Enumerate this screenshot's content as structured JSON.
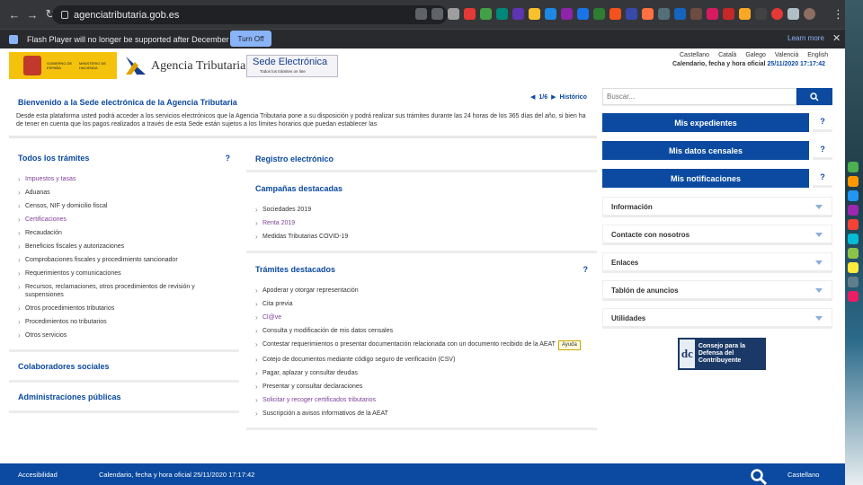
{
  "browser": {
    "url": "agenciatributaria.gob.es",
    "flash_message": "Flash Player will no longer be supported after December 2020.",
    "turn_off_label": "Turn Off",
    "learn_more_label": "Learn more",
    "close_label": "✕",
    "back": "←",
    "forward": "→",
    "reload": "↻",
    "menu": "⋮"
  },
  "header": {
    "gov_text": "GOBIERNO DE ESPAÑA",
    "ministry_text": "MINISTERIO DE HACIENDA",
    "agency_title": "Agencia Tributaria",
    "sede_title": "Sede Electrónica",
    "sede_subtitle": "Todos los trámites on line",
    "languages": [
      "Castellano",
      "Català",
      "Galego",
      "Valencià",
      "English"
    ],
    "datetime_label": "Calendario, fecha y hora oficial",
    "datetime_value": "25/11/2020 17:17:42"
  },
  "welcome": {
    "title": "Bienvenido a la Sede electrónica de la Agencia Tributaria",
    "text": "Desde esta plataforma usted podrá acceder a los servicios electrónicos que la Agencia Tributaria pone a su disposición y podrá realizar sus trámites durante las 24 horas de los 365 días del año, si bien ha de tener en cuenta que los pagos realizados a través de esta Sede están sujetos a los límites horarios que puedan establecer las",
    "pager": "1/6",
    "historico": "Histórico"
  },
  "todos": {
    "title": "Todos los trámites",
    "help": "?",
    "items": [
      {
        "label": "Impuestos y tasas",
        "link": true
      },
      {
        "label": "Aduanas",
        "link": false
      },
      {
        "label": "Censos, NIF y domicilio fiscal",
        "link": false
      },
      {
        "label": "Certificaciones",
        "link": true
      },
      {
        "label": "Recaudación",
        "link": false
      },
      {
        "label": "Beneficios fiscales y autorizaciones",
        "link": false
      },
      {
        "label": "Comprobaciones fiscales y procedimiento sancionador",
        "link": false
      },
      {
        "label": "Requerimientos y comunicaciones",
        "link": false
      },
      {
        "label": "Recursos, reclamaciones, otros procedimientos de revisión y suspensiones",
        "link": false
      },
      {
        "label": "Otros procedimientos tributarios",
        "link": false
      },
      {
        "label": "Procedimientos no tributarios",
        "link": false
      },
      {
        "label": "Otros servicios",
        "link": false
      }
    ]
  },
  "colaboradores": "Colaboradores sociales",
  "administraciones": "Administraciones públicas",
  "registro": "Registro electrónico",
  "campanas": {
    "title": "Campañas destacadas",
    "items": [
      {
        "label": "Sociedades 2019",
        "link": false
      },
      {
        "label": "Renta 2019",
        "link": true
      },
      {
        "label": "Medidas Tributarias COVID-19",
        "link": false
      }
    ]
  },
  "tramites": {
    "title": "Trámites destacados",
    "help": "?",
    "items": [
      {
        "label": "Apoderar y otorgar representación",
        "link": false
      },
      {
        "label": "Cita previa",
        "link": false
      },
      {
        "label": "Cl@ve",
        "link": true
      },
      {
        "label": "Consulta y modificación de mis datos censales",
        "link": false
      },
      {
        "label": "Contestar requerimientos o presentar documentación relacionada con un documento recibido de la AEAT",
        "link": false
      },
      {
        "label": "Cotejo de documentos mediante código seguro de verificación (CSV)",
        "link": false
      },
      {
        "label": "Pagar, aplazar y consultar deudas",
        "link": false
      },
      {
        "label": "Presentar y consultar declaraciones",
        "link": false
      },
      {
        "label": "Solicitar y recoger certificados tributarios",
        "link": true
      },
      {
        "label": "Suscripción a avisos informativos de la AEAT",
        "link": false
      }
    ],
    "tooltip": "Ayuda"
  },
  "sidebar": {
    "search_placeholder": "Buscar...",
    "buttons": [
      {
        "label": "Mis expedientes",
        "help": "?"
      },
      {
        "label": "Mis datos censales",
        "help": "?"
      },
      {
        "label": "Mis notificaciones",
        "help": "?"
      }
    ],
    "accordions": [
      "Información",
      "Contacte con nosotros",
      "Enlaces",
      "Tablón de anuncios",
      "Utilidades"
    ],
    "consejo_logo": "dc",
    "consejo_text": "Consejo para la Defensa del Contribuyente"
  },
  "footer": {
    "accesibilidad": "Accesibilidad",
    "datetime": "Calendario, fecha y hora oficial 25/11/2020 17:17:42",
    "lang": "Castellano"
  },
  "colors": {
    "primary": "#0b4aa0",
    "link_visited": "#7f3f98",
    "gov_yellow": "#f4c20d"
  }
}
